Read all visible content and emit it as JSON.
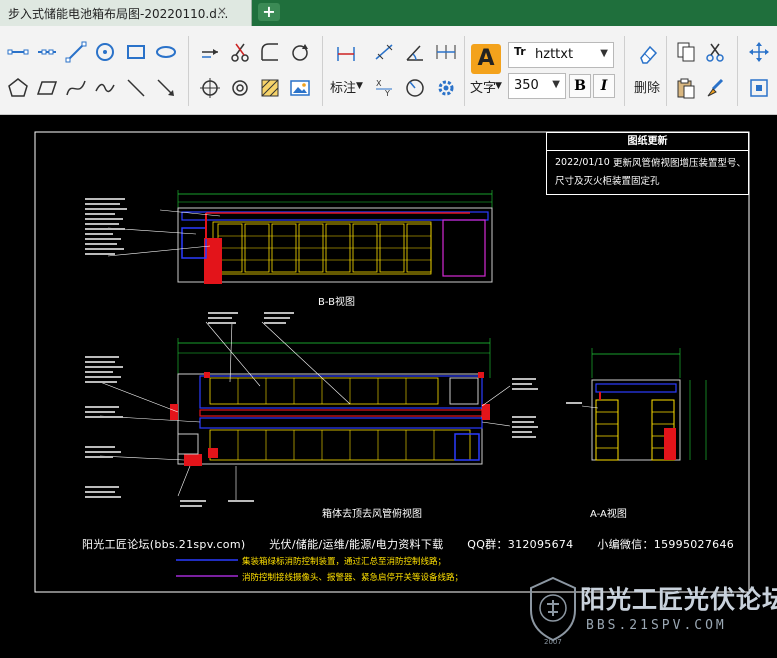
{
  "tab": {
    "title": "步入式储能电池箱布局图-20220110.d...",
    "close_glyph": "×",
    "new_tab_glyph": "+"
  },
  "toolbar": {
    "dimension_label": "标注",
    "text_label": "文字",
    "text_icon_glyph": "A",
    "font_icon_glyph": "Tr",
    "font_name": "hzttxt",
    "font_size": "350",
    "bold_label": "B",
    "italic_label": "I",
    "delete_label": "删除",
    "dropdown_glyph": "▼",
    "icons": {
      "draw": [
        "line-icon",
        "polyline-icon",
        "arc-icon",
        "circle-icon",
        "rectangle-icon",
        "ellipse-icon",
        "polygon-icon",
        "parallelogram-icon",
        "spline-icon",
        "diagonal-line-icon",
        "arrow-line-icon"
      ],
      "edit": [
        "move-icon",
        "trim-icon",
        "fillet-icon",
        "rotate-icon",
        "explode-icon",
        "rotate-gear-icon",
        "hatch-icon",
        "image-icon"
      ],
      "measure": [
        "dimension-icon",
        "align-dimension-icon",
        "angle-dimension-icon",
        "continuous-dimension-icon",
        "coordinate-dimension-icon",
        "radius-dimension-icon",
        "settings-icon"
      ],
      "clipboard": [
        "copy-icon",
        "cut-icon",
        "paste-icon",
        "match-properties-icon",
        "pan-icon",
        "zoom-icon"
      ]
    }
  },
  "drawing": {
    "changes_header": "图纸更新",
    "changes_date": "2022/01/10",
    "changes_line1": "更新风管俯视图增压装置型号、",
    "changes_line2": "尺寸及灭火柜装置固定孔",
    "view_bb": "B-B视图",
    "view_top": "箱体去顶去风管俯视图",
    "view_aa": "A-A视图",
    "footer": {
      "forum": "阳光工匠论坛(bbs.21spv.com)",
      "topics": "光伏/储能/运维/能源/电力资料下载",
      "qq": "QQ群：312095674",
      "wechat": "小编微信：15995027646"
    },
    "legend": {
      "blue_text": "集装箱绿标消防控制装置，通过汇总至消防控制线路；",
      "purple_text": "消防控制接线摄像头、报警器、紧急启停开关等设备线路；"
    }
  },
  "watermark": {
    "title": "阳光工匠光伏论坛",
    "url": "BBS.21SPV.COM",
    "year": "2007"
  },
  "colors": {
    "tab_bar": "#1f6f3c",
    "toolbar_bg": "#f3f3f3",
    "canvas_bg": "#000000",
    "cad_yellow": "#ffe100",
    "cad_green": "#22d33a",
    "cad_blue": "#2b3cff",
    "cad_red": "#e3141a",
    "cad_magenta": "#d42ad4",
    "cad_cyan": "#2fd6e0"
  }
}
